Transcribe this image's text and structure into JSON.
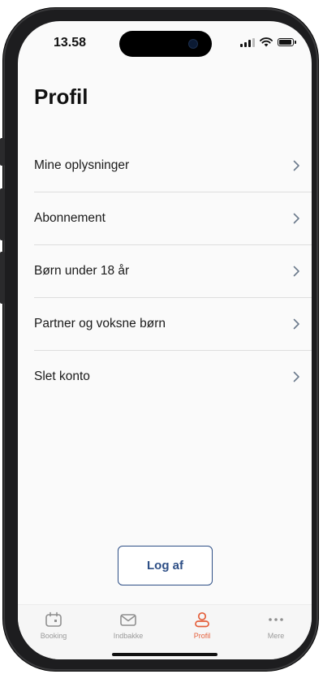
{
  "status_bar": {
    "time": "13.58"
  },
  "page": {
    "title": "Profil"
  },
  "menu": {
    "items": [
      {
        "label": "Mine oplysninger",
        "icon": "chevron-right-icon"
      },
      {
        "label": "Abonnement",
        "icon": "chevron-right-icon"
      },
      {
        "label": "Børn under 18 år",
        "icon": "chevron-right-icon"
      },
      {
        "label": "Partner og voksne børn",
        "icon": "chevron-right-icon"
      },
      {
        "label": "Slet konto",
        "icon": "chevron-right-icon"
      }
    ]
  },
  "logout": {
    "label": "Log af"
  },
  "tab_bar": {
    "tabs": [
      {
        "label": "Booking",
        "icon": "calendar-icon",
        "active": false
      },
      {
        "label": "Indbakke",
        "icon": "mail-icon",
        "active": false
      },
      {
        "label": "Profil",
        "icon": "person-icon",
        "active": true
      },
      {
        "label": "Mere",
        "icon": "more-dots-icon",
        "active": false
      }
    ]
  },
  "colors": {
    "accent": "#e4603c",
    "button_blue": "#2e4f86",
    "inactive_gray": "#9a9a9a",
    "background": "#fafafa"
  }
}
